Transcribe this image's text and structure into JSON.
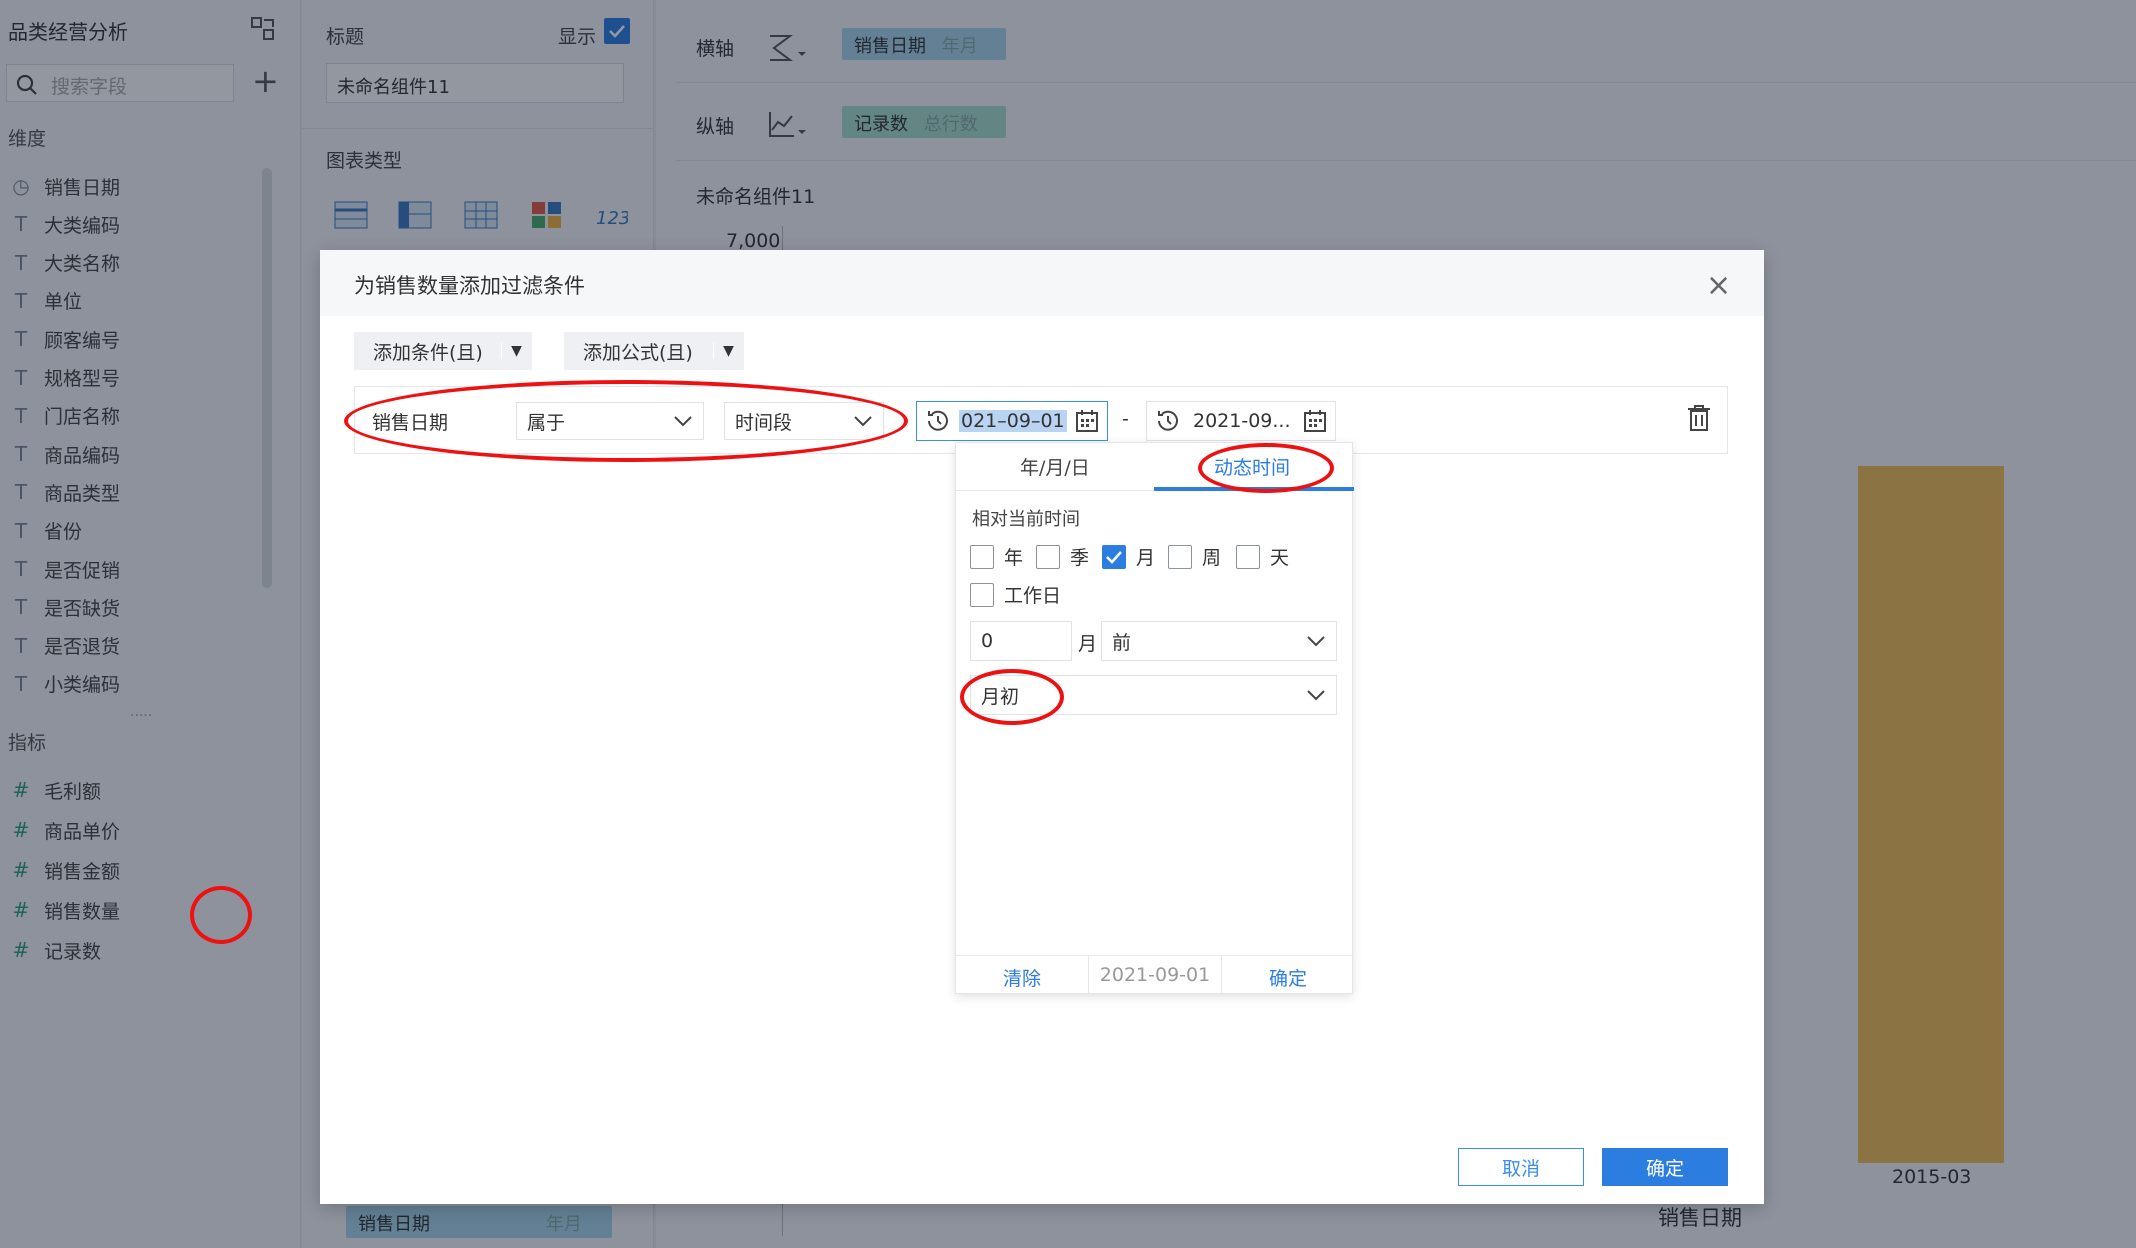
{
  "left_panel": {
    "title": "品类经营分析",
    "search_placeholder": "搜索字段",
    "dimensions_label": "维度",
    "dimensions": [
      "销售日期",
      "大类编码",
      "大类名称",
      "单位",
      "顾客编号",
      "规格型号",
      "门店名称",
      "商品编码",
      "商品类型",
      "省份",
      "是否促销",
      "是否缺货",
      "是否退货",
      "小类编码"
    ],
    "metrics_label": "指标",
    "metrics": [
      "毛利额",
      "商品单价",
      "销售金额",
      "销售数量",
      "记录数"
    ]
  },
  "middle_panel": {
    "title_label": "标题",
    "show_label": "显示",
    "title_value": "未命名组件11",
    "chart_type_label": "图表类型",
    "bottom_pill": "销售日期",
    "bottom_pill_sub": "年月"
  },
  "right_area": {
    "x_axis_label": "横轴",
    "x_pill": "销售日期",
    "x_pill_sub": "年月",
    "y_axis_label": "纵轴",
    "y_pill": "记录数",
    "y_pill_sub": "总行数",
    "component_title": "未命名组件11",
    "y_tick_top": "7,000",
    "x_tick": "2015-03",
    "x_axis_title": "销售日期"
  },
  "dialog": {
    "title": "为销售数量添加过滤条件",
    "add_condition": "添加条件(且)",
    "add_formula": "添加公式(且)",
    "field": "销售日期",
    "operator": "属于",
    "range_type": "时间段",
    "start_date": "021–09–01",
    "range_sep": "-",
    "end_date": "2021-09...",
    "cancel": "取消",
    "confirm": "确定"
  },
  "popup": {
    "tab_ymd": "年/月/日",
    "tab_dynamic": "动态时间",
    "relative_label": "相对当前时间",
    "units": [
      {
        "label": "年",
        "checked": false
      },
      {
        "label": "季",
        "checked": false
      },
      {
        "label": "月",
        "checked": true
      },
      {
        "label": "周",
        "checked": false
      },
      {
        "label": "天",
        "checked": false
      }
    ],
    "workday_label": "工作日",
    "offset_value": "0",
    "offset_unit": "月",
    "direction": "前",
    "anchor": "月初",
    "clear": "清除",
    "preview_date": "2021-09-01",
    "confirm": "确定"
  }
}
